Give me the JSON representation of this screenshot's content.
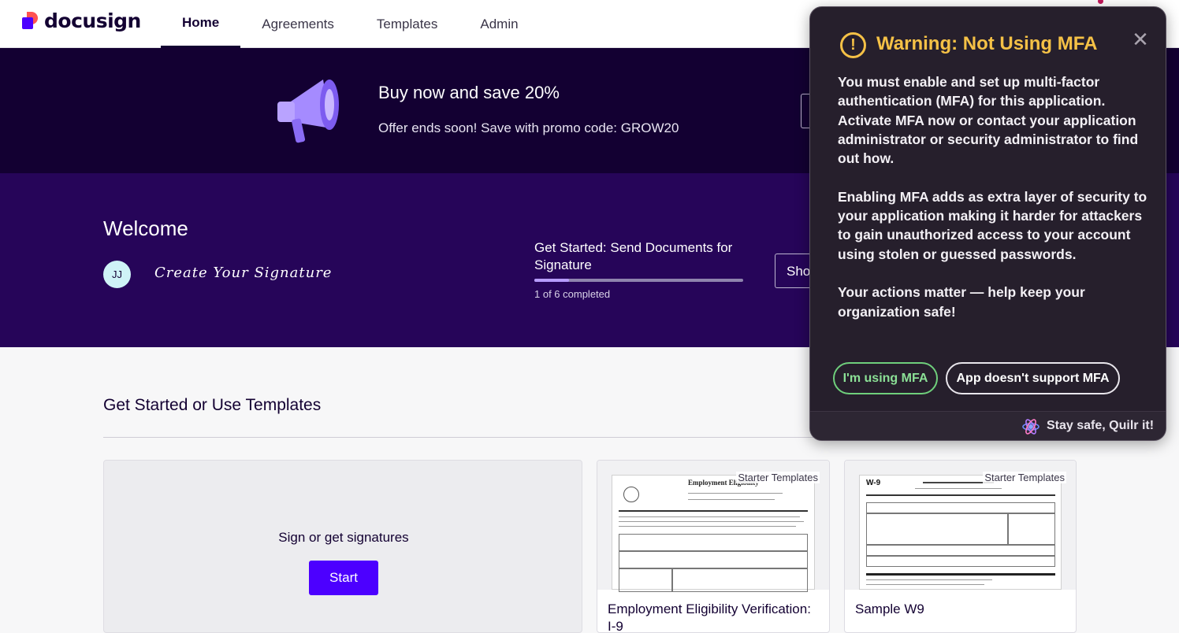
{
  "brand": {
    "name": "docusign"
  },
  "nav": {
    "tabs": [
      {
        "label": "Home",
        "active": true
      },
      {
        "label": "Agreements",
        "active": false
      },
      {
        "label": "Templates",
        "active": false
      },
      {
        "label": "Admin",
        "active": false
      }
    ]
  },
  "promo": {
    "title": "Buy now and save 20%",
    "subtitle": "Offer ends soon! Save with promo code: GROW20",
    "icon": "megaphone-icon"
  },
  "welcome": {
    "title": "Welcome",
    "avatar_initials": "JJ",
    "signature_prompt": "Create Your Signature",
    "get_started_title": "Get Started: Send Documents for Signature",
    "progress": {
      "completed": 1,
      "total": 6,
      "label": "1 of 6 completed"
    },
    "show_button_label": "Sho"
  },
  "main": {
    "section_title": "Get Started or Use Templates",
    "sign_card": {
      "label": "Sign or get signatures",
      "button": "Start"
    },
    "templates": [
      {
        "tag": "Starter Templates",
        "name": "Employment Eligibility Verification: I-9",
        "thumb_title": "Employment Eligibility"
      },
      {
        "tag": "Starter Templates",
        "name": "Sample W9",
        "thumb_title": "W-9"
      }
    ]
  },
  "mfa_modal": {
    "title": "Warning: Not Using MFA",
    "paragraphs": [
      "You must enable and set up multi-factor authentication (MFA) for this application. Activate MFA now or contact your application administrator or security administrator to find out how.",
      "Enabling MFA adds as extra layer of security to your application making it harder for attackers to gain unauthorized access to your account using stolen or guessed passwords.",
      "Your actions matter — help keep your organization safe!"
    ],
    "primary_button": "I'm using MFA",
    "secondary_button": "App doesn't support MFA",
    "footer": "Stay safe, Quilr it!",
    "close_symbol": "✕",
    "colors": {
      "accent": "#f5c146",
      "success": "#6fcf7c",
      "background": "#261f2c"
    }
  },
  "colors": {
    "brand_purple": "#4c00ff",
    "banner_dark": "#130032",
    "welcome_bg": "#260559"
  }
}
